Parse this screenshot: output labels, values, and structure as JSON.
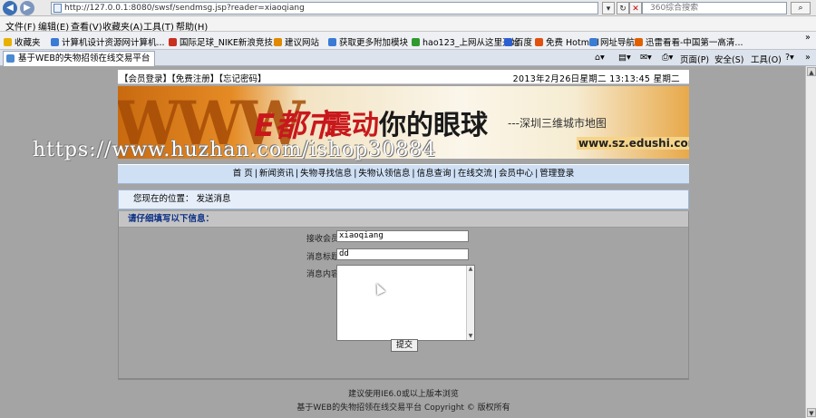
{
  "browser": {
    "url": "http://127.0.0.1:8080/swsf/sendmsg.jsp?reader=xiaoqiang",
    "search_placeholder": "360综合搜索",
    "menu": [
      "文件(F)",
      "编辑(E)",
      "查看(V)",
      "收藏夹(A)",
      "工具(T)",
      "帮助(H)"
    ],
    "favorites": [
      {
        "label": "收藏夹",
        "color": "#e8b000"
      },
      {
        "label": "计算机设计资源网计算机...",
        "color": "#3a7bd5"
      },
      {
        "label": "国际足球_NIKE新浪竞技...",
        "color": "#c83020"
      },
      {
        "label": "建议网站",
        "color": "#e08a00"
      },
      {
        "label": "获取更多附加模块",
        "color": "#3a7bd5"
      },
      {
        "label": "hao123_上网从这里开始",
        "color": "#2f9a2f"
      },
      {
        "label": "百度",
        "color": "#2c5fd1"
      },
      {
        "label": "免费 Hotmail",
        "color": "#e05010"
      },
      {
        "label": "网址导航",
        "color": "#3a7bd5"
      },
      {
        "label": "迅雷看看-中国第一高清...",
        "color": "#e06000"
      }
    ],
    "tab_title": "基于WEB的失物招领在线交易平台",
    "commands": [
      "页面(P)",
      "安全(S)",
      "工具(O)"
    ]
  },
  "site": {
    "top_links": [
      "【会员登录】",
      "【免费注册】",
      "【忘记密码】"
    ],
    "date": "2013年2月26日星期二 13:13:45 星期二",
    "banner": {
      "logo": "E都市",
      "slogan_a": "震",
      "slogan_b": "动",
      "slogan_c": "你的眼球",
      "sub": "---深圳三维城市地图",
      "url": "www.sz.edushi.com"
    },
    "watermark": "https://www.huzhan.com/ishop30884",
    "nav": [
      "首 页",
      "新闻资讯",
      "失物寻找信息",
      "失物认领信息",
      "信息查询",
      "在线交流",
      "会员中心",
      "管理登录"
    ],
    "location": "您现在的位置： 发送消息",
    "form": {
      "heading": "请仔细填写以下信息：",
      "receiver_label": "接收会员:",
      "receiver_value": "xiaoqiang",
      "title_label": "消息标题:",
      "title_value": "dd",
      "content_label": "消息内容:",
      "submit": "提交"
    },
    "footer": {
      "line1": "建议使用IE6.0或以上版本浏览",
      "line2": "基于WEB的失物招领在线交易平台 Copyright © 版权所有"
    }
  }
}
